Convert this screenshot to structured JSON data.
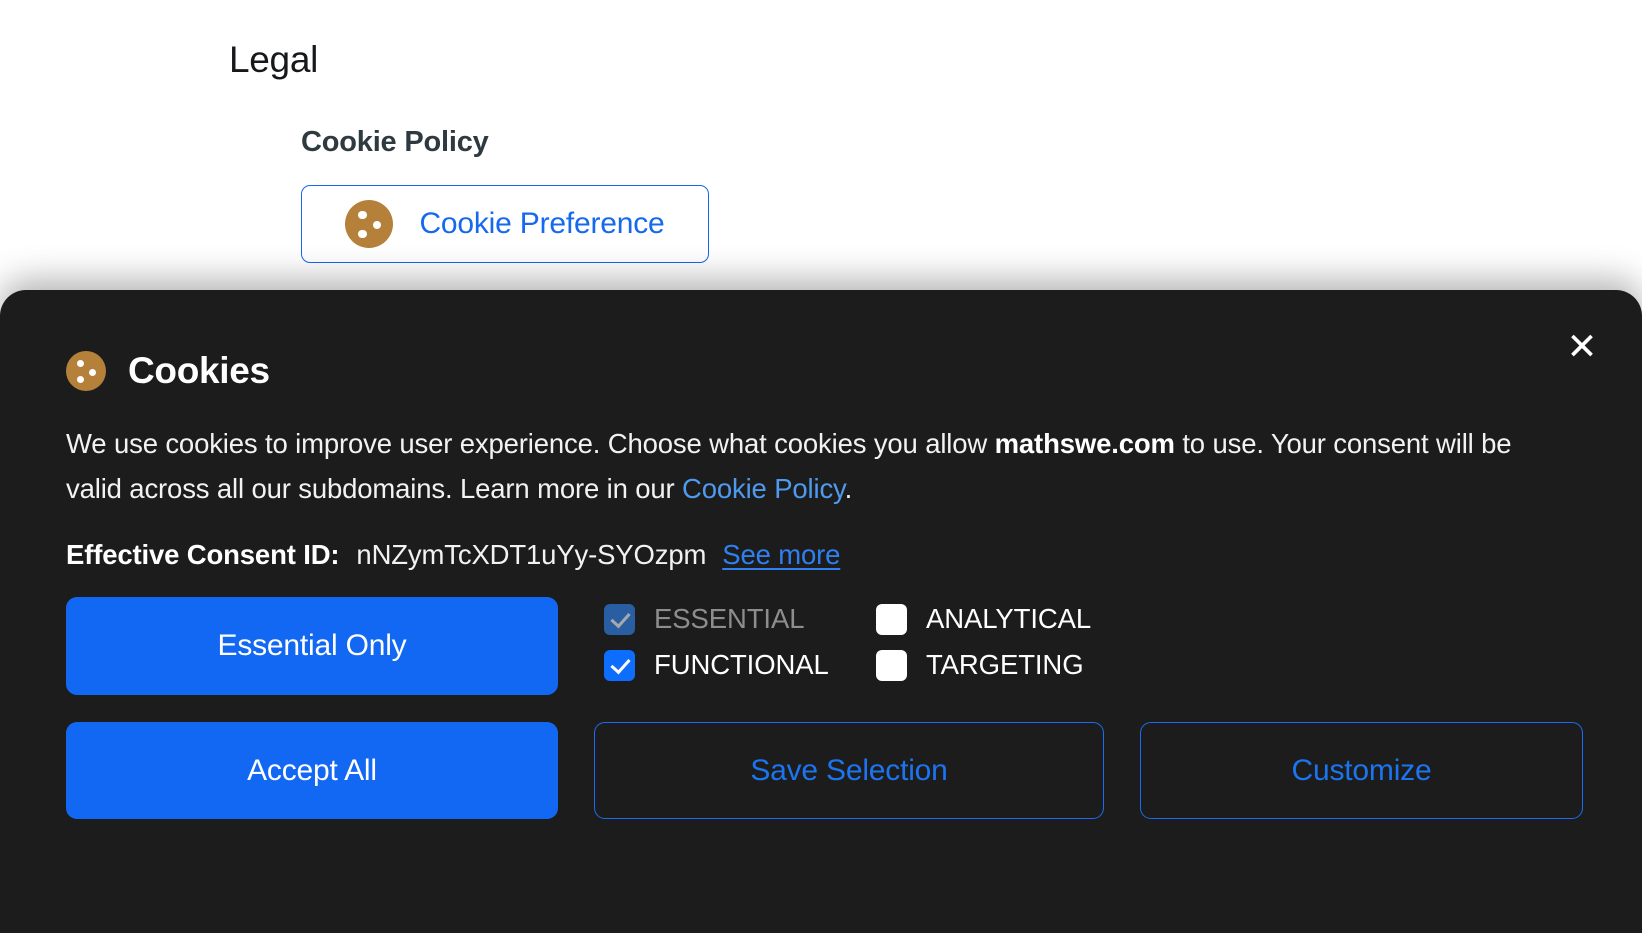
{
  "page": {
    "legal_heading": "Legal",
    "cookie_policy_heading": "Cookie Policy",
    "cookie_preference_button": "Cookie Preference",
    "cookie_icon_name": "cookie-icon",
    "cookie_icon_color": "#b5803a",
    "link_color": "#1668ef"
  },
  "banner": {
    "close_label": "✕",
    "title": "Cookies",
    "body": {
      "part1": "We use cookies to improve user experience. Choose what cookies you allow ",
      "domain": "mathswe.com",
      "part2": " to use. Your consent will be valid across all our subdomains. Learn more in our ",
      "policy_link": "Cookie Policy",
      "part3": "."
    },
    "consent": {
      "label": "Effective Consent ID:",
      "id": "nNZymTcXDT1uYy-SYOzpm",
      "see_more": "See more"
    },
    "categories": [
      {
        "key": "essential",
        "label": "ESSENTIAL",
        "checked": true,
        "disabled": true
      },
      {
        "key": "analytical",
        "label": "ANALYTICAL",
        "checked": false,
        "disabled": false
      },
      {
        "key": "functional",
        "label": "FUNCTIONAL",
        "checked": true,
        "disabled": false
      },
      {
        "key": "targeting",
        "label": "TARGETING",
        "checked": false,
        "disabled": false
      }
    ],
    "buttons": {
      "essential_only": "Essential Only",
      "accept_all": "Accept All",
      "save_selection": "Save Selection",
      "customize": "Customize"
    },
    "colors": {
      "background": "#1c1c1c",
      "primary": "#1268f3",
      "outline": "#1a6df0",
      "link": "#4d9aef",
      "checkbox_on": "#0d6efd",
      "checkbox_disabled": "#2a5ea3",
      "label_disabled": "#8d8d8d"
    }
  }
}
